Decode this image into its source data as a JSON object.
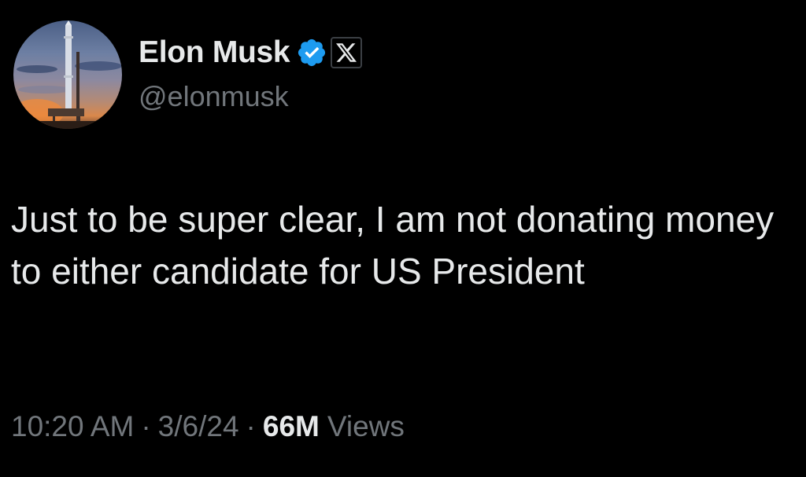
{
  "author": {
    "display_name": "Elon Musk",
    "handle": "@elonmusk",
    "verified_icon": "verified-badge-icon",
    "affiliation_icon": "x-logo-icon",
    "avatar_icon": "starship-avatar"
  },
  "tweet": {
    "text": "Just to be super clear, I am not donating money to either candidate for US President"
  },
  "meta": {
    "time": "10:20 AM",
    "separator": "·",
    "date": "3/6/24",
    "views_count": "66M",
    "views_label": "Views"
  },
  "colors": {
    "background": "#000000",
    "primary_text": "#e7e9ea",
    "secondary_text": "#71767b",
    "verified_blue": "#1d9bf0"
  }
}
